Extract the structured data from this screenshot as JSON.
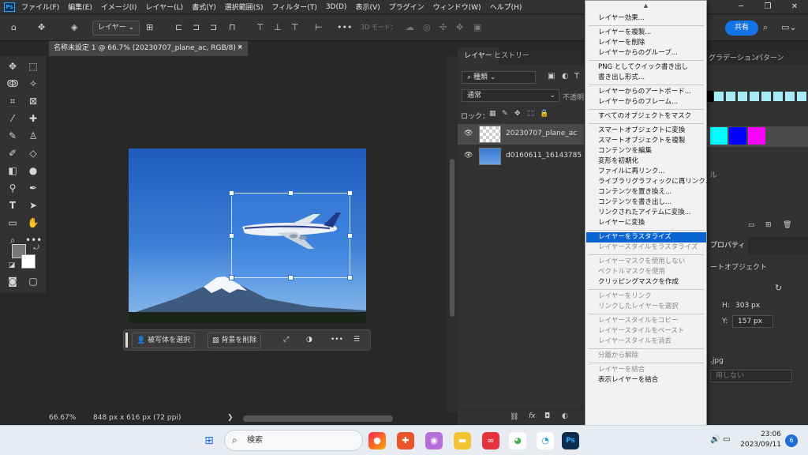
{
  "menubar": {
    "items": [
      "ファイル(F)",
      "編集(E)",
      "イメージ(I)",
      "レイヤー(L)",
      "書式(Y)",
      "選択範囲(S)",
      "フィルター(T)",
      "3D(D)",
      "表示(V)",
      "プラグイン",
      "ウィンドウ(W)",
      "ヘルプ(H)"
    ]
  },
  "optbar": {
    "layer_select": "レイヤー",
    "mode3d": "3D モード：",
    "share": "共有"
  },
  "document": {
    "tab_title": "名称未設定 1 @ 66.7% (20230707_plane_ac, RGB/8) *",
    "zoom": "66.67%",
    "info": "848 px x 616 px (72 ppi)"
  },
  "contextbar": {
    "select_subject": "被写体を選択",
    "remove_bg": "背景を削除",
    "more": "•••"
  },
  "layers": {
    "tabs": [
      "レイヤー",
      "ヒストリー"
    ],
    "filter_kind": "種類",
    "blend_mode": "通常",
    "opacity_label": "不透明",
    "lock_label": "ロック：",
    "rows": [
      {
        "name": "20230707_plane_ac"
      },
      {
        "name": "d0160611_16143785"
      }
    ],
    "fx_label": "fx"
  },
  "rightcol": {
    "tabs": [
      "グラデーション",
      "パターン"
    ],
    "props_tab": "プロパティ",
    "smart_object": "ートオブジェクト",
    "h_label": "H:",
    "h_value": "303 px",
    "y_label": "Y:",
    "y_value": "157 px",
    "partial_1": "ル",
    "file_ext": ".jpg",
    "partial_2": "用しない"
  },
  "context_menu": {
    "scroll_up": "▲",
    "scroll_down": "▼",
    "items": [
      {
        "label": "レイヤー効果...",
        "state": "normal"
      },
      {
        "sep": true
      },
      {
        "label": "レイヤーを複製...",
        "state": "normal"
      },
      {
        "label": "レイヤーを削除",
        "state": "normal"
      },
      {
        "label": "レイヤーからのグループ...",
        "state": "normal"
      },
      {
        "sep": true
      },
      {
        "label": "PNG としてクイック書き出し",
        "state": "normal"
      },
      {
        "label": "書き出し形式...",
        "state": "normal"
      },
      {
        "sep": true
      },
      {
        "label": "レイヤーからのアートボード...",
        "state": "normal"
      },
      {
        "label": "レイヤーからのフレーム...",
        "state": "normal"
      },
      {
        "sep": true
      },
      {
        "label": "すべてのオブジェクトをマスク",
        "state": "normal"
      },
      {
        "sep": true
      },
      {
        "label": "スマートオブジェクトに変換",
        "state": "normal"
      },
      {
        "label": "スマートオブジェクトを複製",
        "state": "normal"
      },
      {
        "label": "コンテンツを編集",
        "state": "normal"
      },
      {
        "label": "変形を初期化",
        "state": "normal"
      },
      {
        "label": "ファイルに再リンク...",
        "state": "normal"
      },
      {
        "label": "ライブラリグラフィックに再リンク...",
        "state": "normal"
      },
      {
        "label": "コンテンツを置き換え...",
        "state": "normal"
      },
      {
        "label": "コンテンツを書き出し...",
        "state": "normal"
      },
      {
        "label": "リンクされたアイテムに変換...",
        "state": "normal"
      },
      {
        "label": "レイヤーに変換",
        "state": "normal"
      },
      {
        "sep": true
      },
      {
        "label": "レイヤーをラスタライズ",
        "state": "selected"
      },
      {
        "label": "レイヤースタイルをラスタライズ",
        "state": "disabled"
      },
      {
        "sep": true
      },
      {
        "label": "レイヤーマスクを使用しない",
        "state": "disabled"
      },
      {
        "label": "ベクトルマスクを使用",
        "state": "disabled"
      },
      {
        "label": "クリッピングマスクを作成",
        "state": "normal"
      },
      {
        "sep": true
      },
      {
        "label": "レイヤーをリンク",
        "state": "disabled"
      },
      {
        "label": "リンクしたレイヤーを選択",
        "state": "disabled"
      },
      {
        "sep": true
      },
      {
        "label": "レイヤースタイルをコピー",
        "state": "disabled"
      },
      {
        "label": "レイヤースタイルをペースト",
        "state": "disabled"
      },
      {
        "label": "レイヤースタイルを消去",
        "state": "disabled"
      },
      {
        "sep": true
      },
      {
        "label": "分離から解除",
        "state": "disabled"
      },
      {
        "sep": true
      },
      {
        "label": "レイヤーを結合",
        "state": "disabled"
      },
      {
        "label": "表示レイヤーを結合",
        "state": "normal"
      }
    ]
  },
  "taskbar": {
    "search": "検索",
    "time": "23:06",
    "date": "2023/09/11",
    "notifications": "6"
  },
  "colors": {
    "accent": "#1473e6",
    "menu_selected": "#0a64d2"
  }
}
